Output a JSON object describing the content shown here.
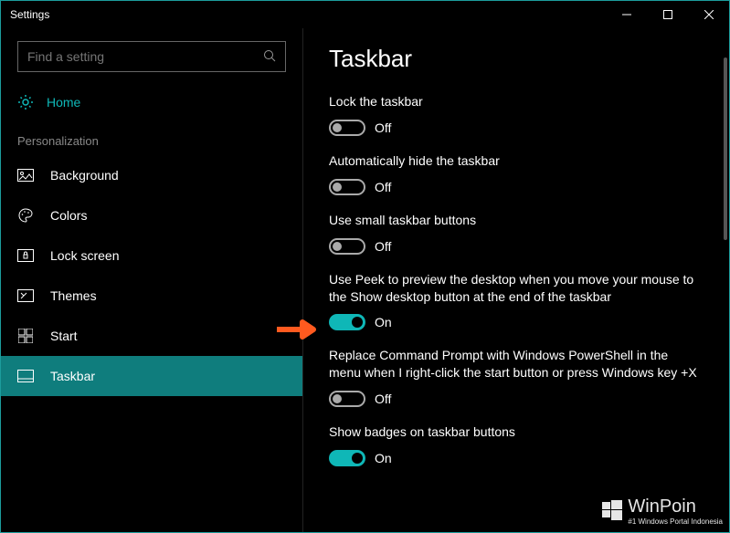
{
  "window": {
    "title": "Settings"
  },
  "search": {
    "placeholder": "Find a setting"
  },
  "home": {
    "label": "Home"
  },
  "section": {
    "label": "Personalization"
  },
  "nav": {
    "background": "Background",
    "colors": "Colors",
    "lockscreen": "Lock screen",
    "themes": "Themes",
    "start": "Start",
    "taskbar": "Taskbar"
  },
  "main": {
    "title": "Taskbar",
    "s1": {
      "label": "Lock the taskbar",
      "state": "Off"
    },
    "s2": {
      "label": "Automatically hide the taskbar",
      "state": "Off"
    },
    "s3": {
      "label": "Use small taskbar buttons",
      "state": "Off"
    },
    "s4": {
      "label": "Use Peek to preview the desktop when you move your mouse to the Show desktop button at the end of the taskbar",
      "state": "On"
    },
    "s5": {
      "label": "Replace Command Prompt with Windows PowerShell in the menu when I right-click the start button or press Windows key +X",
      "state": "Off"
    },
    "s6": {
      "label": "Show badges on taskbar buttons",
      "state": "On"
    }
  },
  "watermark": {
    "brand": "WinPoin",
    "tagline": "#1 Windows Portal Indonesia"
  }
}
